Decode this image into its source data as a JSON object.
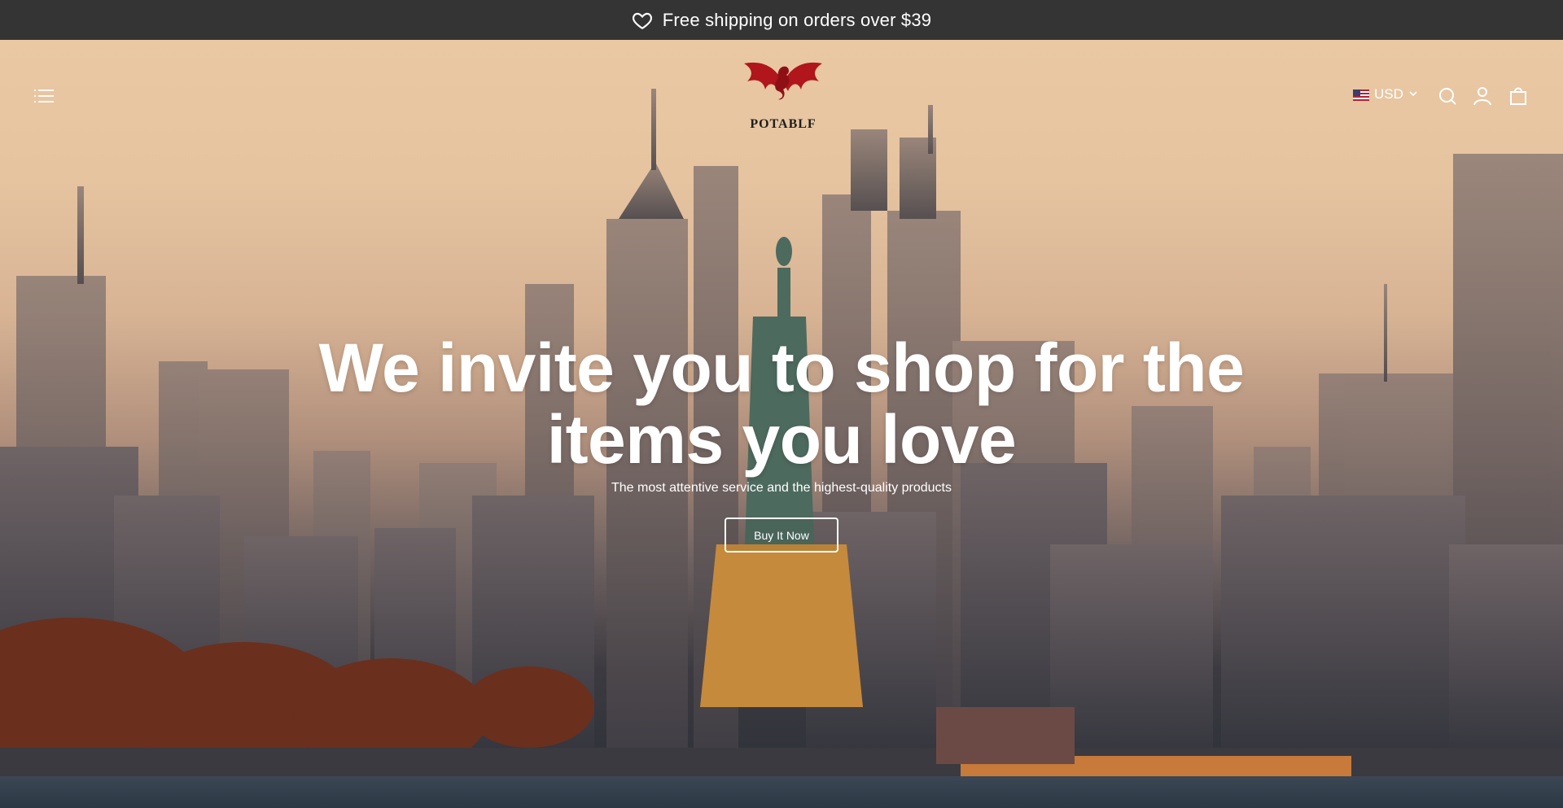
{
  "announcement": {
    "text": "Free shipping on orders over $39",
    "icon": "heart-icon"
  },
  "header": {
    "menu_icon": "hamburger-menu-icon",
    "logo_text": "POTABLF",
    "currency": {
      "code": "USD",
      "flag": "us-flag-icon"
    },
    "icons": [
      "search-icon",
      "account-icon",
      "cart-icon"
    ]
  },
  "hero": {
    "headline": "We invite you to shop for the items you love",
    "subheadline": "The most attentive service and the highest-quality products",
    "cta_label": "Buy It Now"
  },
  "colors": {
    "announcement_bg": "#343434",
    "logo_red": "#b0161c",
    "text_light": "#ffffff"
  }
}
